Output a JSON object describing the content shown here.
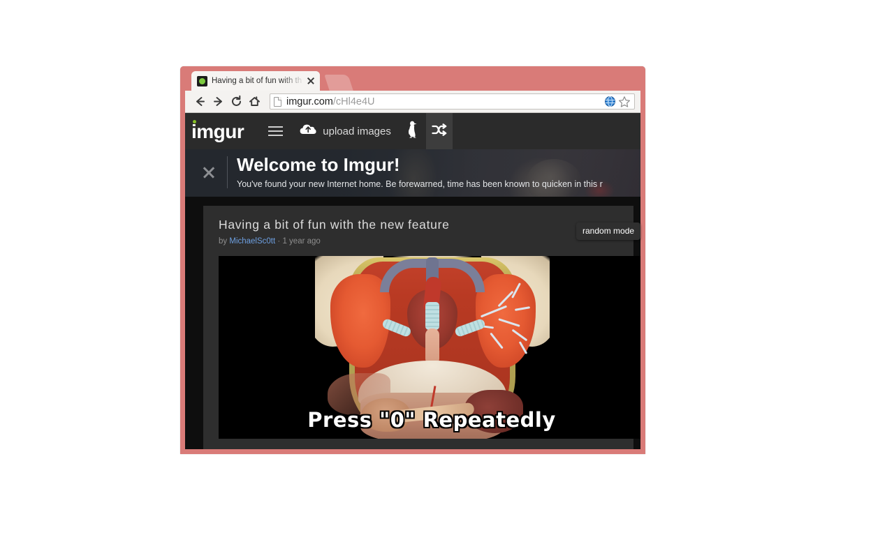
{
  "browser": {
    "tab": {
      "title": "Having a bit of fun with th",
      "favicon_name": "imgur-favicon",
      "close_label": "×"
    },
    "new_tab_label": "+",
    "nav": {
      "back_label": "Back",
      "forward_label": "Forward",
      "reload_label": "Reload",
      "home_label": "Home"
    },
    "url": {
      "host": "imgur.com",
      "path": "/cHl4e4U",
      "full": "imgur.com/cHl4e4U"
    },
    "extension_icon_name": "globe-icon",
    "bookmark_icon_name": "star-icon",
    "frame_color": "#d97b78"
  },
  "site": {
    "header": {
      "logo_text": "imgur",
      "logo_dot_color": "#85bf25",
      "menu_label": "menu",
      "upload_label": "upload images",
      "penguin_label": "penguin",
      "random_label": "random mode",
      "background_color": "#2b2b2b"
    },
    "tooltip": {
      "text": "random mode"
    },
    "banner": {
      "close_label": "×",
      "title": "Welcome to Imgur!",
      "subtitle": "You've found your new Internet home. Be forewarned, time has been known to quicken in this r"
    },
    "post": {
      "title": "Having a bit of fun with the new feature",
      "by_label": "by",
      "author": "MichaelSc0tt",
      "separator": "·",
      "timestamp": "1 year ago",
      "image": {
        "alt": "anatomical-torso-illustration",
        "caption": "Press \"0\" Repeatedly"
      }
    }
  }
}
